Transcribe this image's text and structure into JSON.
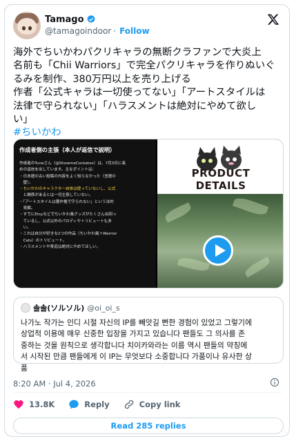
{
  "author": {
    "display_name": "Tamago",
    "handle": "@tamagoindoor",
    "separator": "·",
    "follow_label": "Follow"
  },
  "tweet": {
    "lines": [
      "海外でちいかわパクリキャラの無断クラファンで大炎上",
      "名前も「Chii Warriors」で完全パクリキャラを作りぬいぐ",
      "るみを制作、380万円以上を売り上げる",
      "作者「公式キャラは一切使ってない」「アートスタイルは",
      "法律で守られない」「ハラスメントは絶対にやめて欲し",
      "い」"
    ],
    "hashtag": "#ちいかわ"
  },
  "media": {
    "left_title": "作成者側の主張（本人が返信で説明）",
    "left_lines": [
      "作成者のTuneさん（@ShowmeCockatoo）は、7月3日に長",
      "めの返信を出しています。主なポイントは：",
      "",
      "・日本語の古い投稿の内容をよく知らなかった（言語の",
      "　壁）。",
      "・ちいかわのキャラクター自体は使っていないし、公式",
      "　と関係があるとは一切主張していない。",
      "",
      "・「アートスタイルは著作権で守られない」という法的",
      "　見解。",
      "",
      "・すでにEtsyなどでちいかわ風グッズがたくさん出回っ",
      "　ているし、公式以外のパロディやトリビュートも多",
      "　い。",
      "・これは自分が好きな2つの作品（ちいかわ風＋Warrior",
      "　Cats）のトリビュート。",
      "・ハラスメントや脅迫は絶対にやめてほしい。"
    ],
    "highlight": "キャラクター自体は使っていない",
    "product_title_1": "PRODUCT",
    "product_title_2": "DETAILS"
  },
  "quote": {
    "name": "솔솔(ソルソル)",
    "handle": "@oi_oi_s",
    "lines": [
      "나가노 작가는 인디 시절 자신의 IP를 빼앗길 뻔한 경험이 있었고 그렇기에",
      "상업적 이용에 매우 신중한 입장을 가지고 있습니다 팬들도 그 의사를 존",
      "중하는 것을 원칙으로 생각합니다 치이카와라는 이름 역시 팬들의 약칭에",
      "서 시작된 만큼 팬들에게 이 IP는 무엇보다 소중합니다 가품이나 유사한 상",
      "품"
    ]
  },
  "meta": {
    "timestamp": "8:20 AM · Jul 4, 2026"
  },
  "actions": {
    "likes": "13.8K",
    "reply": "Reply",
    "copy_link": "Copy link",
    "read_replies": "Read 285 replies"
  },
  "colors": {
    "accent": "#1d9bf0",
    "like_red": "#f91880",
    "muted": "#536471",
    "border": "#cfd9de"
  }
}
